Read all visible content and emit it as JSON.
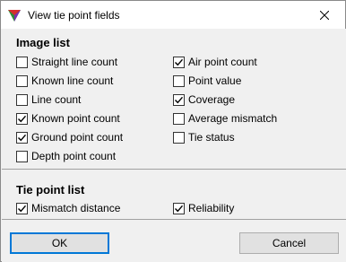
{
  "window": {
    "title": "View tie point fields",
    "close_icon": "close-icon"
  },
  "image_list": {
    "heading": "Image list",
    "items": [
      {
        "label": "Straight line count",
        "checked": false
      },
      {
        "label": "Known line count",
        "checked": false
      },
      {
        "label": "Line count",
        "checked": false
      },
      {
        "label": "Known point count",
        "checked": true
      },
      {
        "label": "Ground point count",
        "checked": true
      },
      {
        "label": "Depth point count",
        "checked": false
      },
      {
        "label": "Air point count",
        "checked": true
      },
      {
        "label": "Point value",
        "checked": false
      },
      {
        "label": "Coverage",
        "checked": true
      },
      {
        "label": "Average mismatch",
        "checked": false
      },
      {
        "label": "Tie status",
        "checked": false
      }
    ]
  },
  "tie_point_list": {
    "heading": "Tie point list",
    "items": [
      {
        "label": "Mismatch distance",
        "checked": true
      },
      {
        "label": "Reliability",
        "checked": true
      }
    ]
  },
  "buttons": {
    "ok": "OK",
    "cancel": "Cancel"
  }
}
